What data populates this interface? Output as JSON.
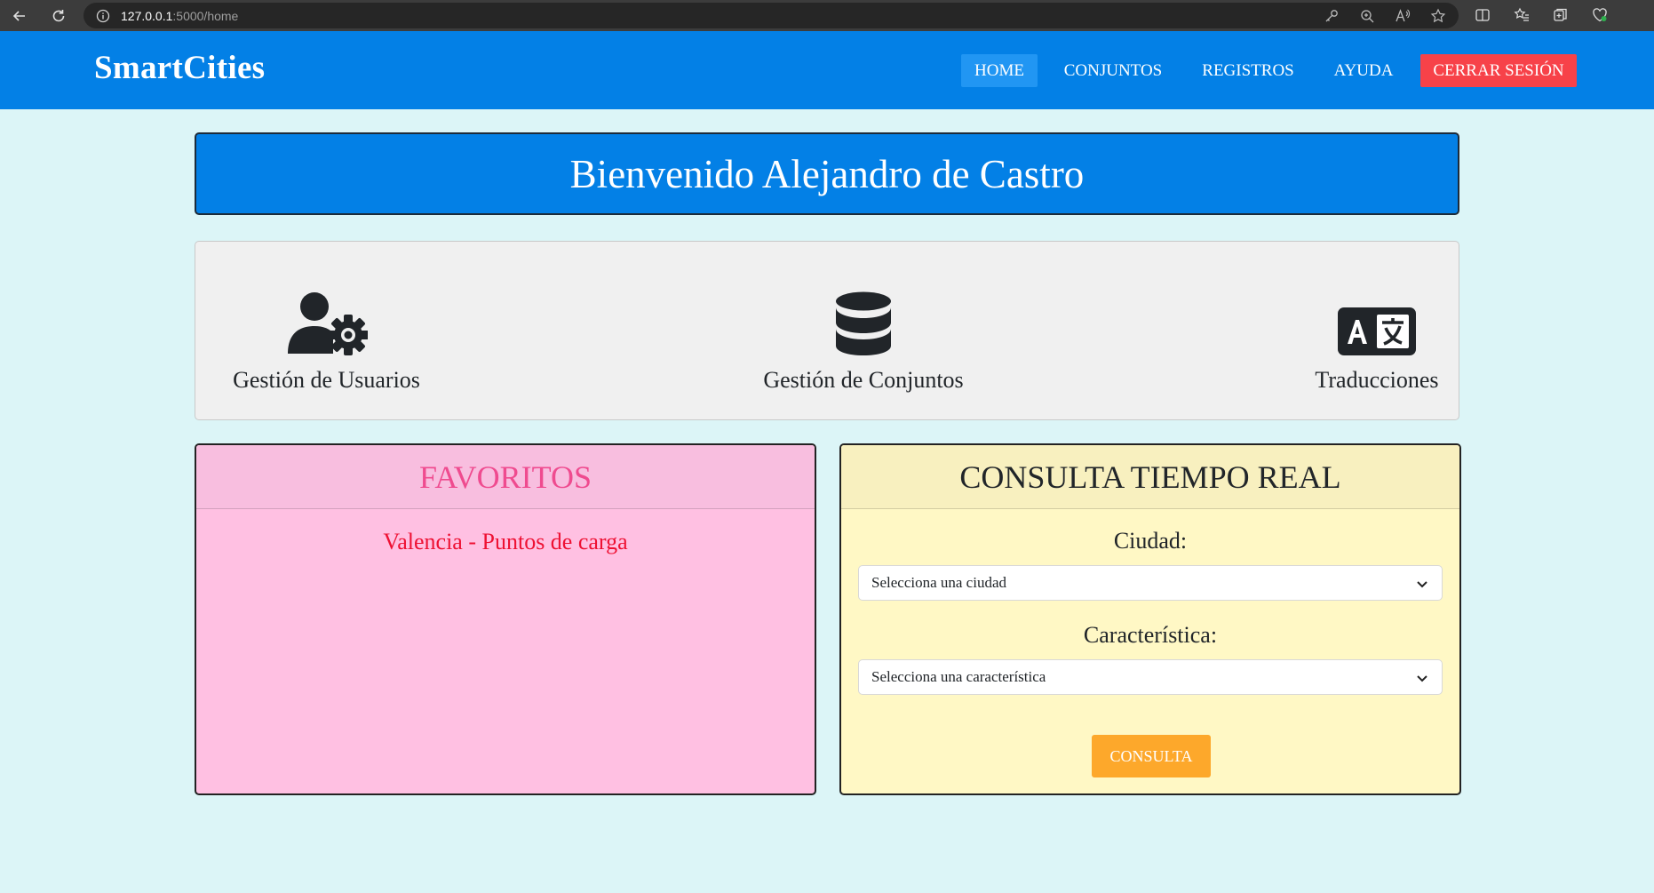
{
  "browser": {
    "url_host": "127.0.0.1",
    "url_path": ":5000/home"
  },
  "navbar": {
    "brand": "SmartCities",
    "links": [
      {
        "label": "HOME"
      },
      {
        "label": "CONJUNTOS"
      },
      {
        "label": "REGISTROS"
      },
      {
        "label": "AYUDA"
      }
    ],
    "logout_label": "CERRAR SESIÓN"
  },
  "banner": {
    "welcome": "Bienvenido Alejandro de Castro"
  },
  "tools": [
    {
      "label": "Gestión de Usuarios",
      "icon": "user-gear-icon"
    },
    {
      "label": "Gestión de Conjuntos",
      "icon": "database-icon"
    },
    {
      "label": "Traducciones",
      "icon": "language-icon"
    }
  ],
  "favorites": {
    "title": "FAVORITOS",
    "items": [
      "Valencia - Puntos de carga"
    ]
  },
  "realtime": {
    "title": "CONSULTA TIEMPO REAL",
    "city_label": "Ciudad:",
    "city_value": "Selecciona una ciudad",
    "feature_label": "Característica:",
    "feature_value": "Selecciona una característica",
    "button": "CONSULTA"
  },
  "colors": {
    "primary": "#0380e6",
    "background": "#dcf5f7",
    "logout": "#f74249",
    "favorites_bg": "#ffc0e2",
    "favorites_title": "#ef4b8f",
    "favorite_item": "#ee1133",
    "realtime_bg": "#fff8c5",
    "consulta_button": "#fda82b"
  }
}
